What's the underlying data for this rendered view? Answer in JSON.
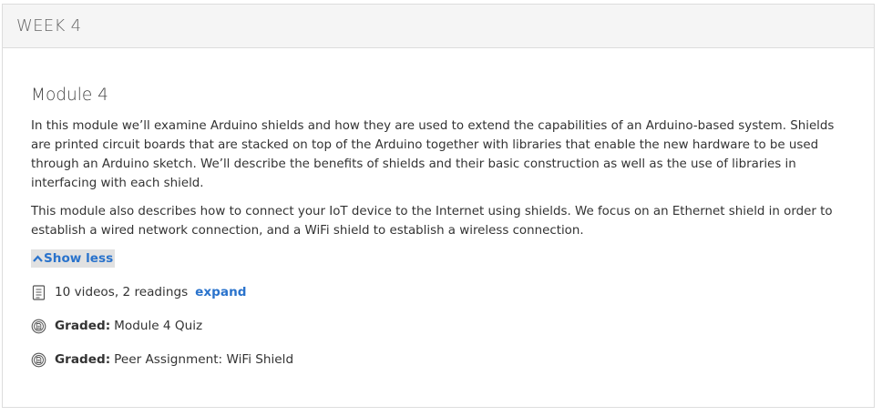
{
  "week": {
    "title": "WEEK 4"
  },
  "module": {
    "title": "Module 4",
    "paragraphs": [
      "In this module we’ll examine Arduino shields and how they are used to extend the capabilities of an Arduino-based system. Shields are printed circuit boards that are stacked on top of the Arduino together with libraries that enable the new hardware to be used through an Arduino sketch. We’ll describe the benefits of shields and their basic construction as well as the use of libraries in interfacing with each shield.",
      "This module also describes how to connect your IoT device to the Internet using shields. We focus on an Ethernet shield in order to establish a wired network connection, and a WiFi shield to establish a wireless connection."
    ],
    "show_less_label": "Show less",
    "show_less_icon": "chevron-up-icon",
    "content_summary": {
      "icon": "document-icon",
      "text": "10 videos, 2 readings",
      "expand_label": "expand"
    },
    "graded_items": [
      {
        "icon": "graded-badge-icon",
        "label": "Graded:",
        "name": "Module 4 Quiz"
      },
      {
        "icon": "graded-badge-icon",
        "label": "Graded:",
        "name": "Peer Assignment: WiFi Shield"
      }
    ]
  },
  "colors": {
    "link": "#2a73cc",
    "header_bg": "#f5f5f5",
    "border": "#dddddd",
    "show_less_bg": "#e1e1e1"
  }
}
